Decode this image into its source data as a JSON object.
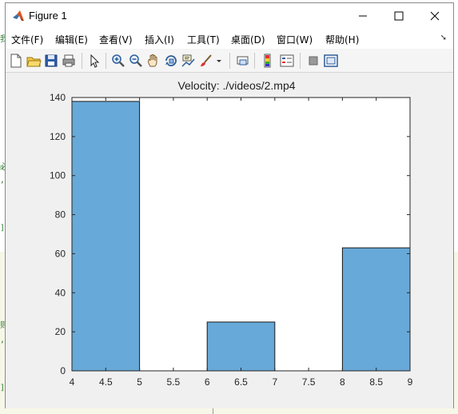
{
  "window": {
    "title": "Figure 1"
  },
  "menu": {
    "items": [
      "文件(F)",
      "编辑(E)",
      "查看(V)",
      "插入(I)",
      "工具(T)",
      "桌面(D)",
      "窗口(W)",
      "帮助(H)"
    ]
  },
  "toolbar": {
    "icons": [
      "new-figure-icon",
      "open-file-icon",
      "save-icon",
      "print-icon",
      "pointer-icon",
      "zoom-in-icon",
      "zoom-out-icon",
      "pan-icon",
      "rotate-3d-icon",
      "data-cursor-icon",
      "brush-icon",
      "link-plot-icon",
      "colorbar-icon",
      "legend-icon",
      "hide-plot-tools-icon",
      "show-plot-tools-icon"
    ]
  },
  "colors": {
    "bar_fill": "#67a9d8",
    "bar_edge": "#1a1a1a",
    "axes_bg": "#ffffff"
  },
  "chart_data": {
    "type": "bar",
    "title": "Velocity: ./videos/2.mp4",
    "xlabel": "",
    "ylabel": "",
    "x_ticks": [
      "4",
      "4.5",
      "5",
      "5.5",
      "6",
      "6.5",
      "7",
      "7.5",
      "8",
      "8.5",
      "9"
    ],
    "y_ticks": [
      "0",
      "20",
      "40",
      "60",
      "80",
      "100",
      "120",
      "140"
    ],
    "xlim": [
      4,
      9
    ],
    "ylim": [
      0,
      140
    ],
    "bins": [
      {
        "from": 4,
        "to": 5,
        "value": 138
      },
      {
        "from": 6,
        "to": 7,
        "value": 25
      },
      {
        "from": 8,
        "to": 9,
        "value": 63
      }
    ],
    "grid": false
  }
}
